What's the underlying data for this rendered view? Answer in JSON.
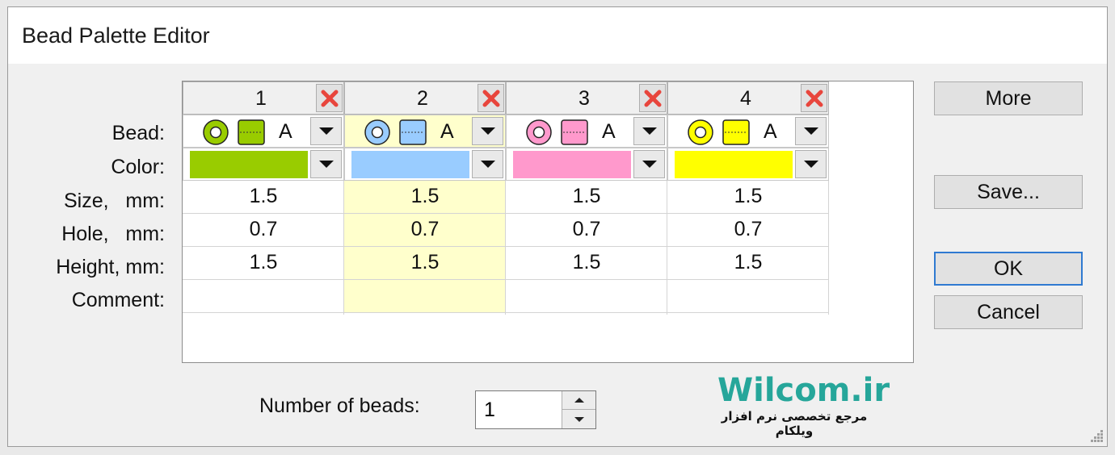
{
  "window": {
    "title": "Bead Palette Editor"
  },
  "row_labels": {
    "bead": "Bead:",
    "color": "Color:",
    "size": "Size,   mm:",
    "hole": "Hole,   mm:",
    "height": "Height, mm:",
    "comment": "Comment:"
  },
  "columns": [
    {
      "number": "1",
      "letter": "A",
      "color": "#99cc00",
      "size": "1.5",
      "hole": "0.7",
      "height": "1.5",
      "comment": "",
      "selected": false
    },
    {
      "number": "2",
      "letter": "A",
      "color": "#99ccff",
      "size": "1.5",
      "hole": "0.7",
      "height": "1.5",
      "comment": "",
      "selected": true
    },
    {
      "number": "3",
      "letter": "A",
      "color": "#ff99cc",
      "size": "1.5",
      "hole": "0.7",
      "height": "1.5",
      "comment": "",
      "selected": false
    },
    {
      "number": "4",
      "letter": "A",
      "color": "#ffff00",
      "size": "1.5",
      "hole": "0.7",
      "height": "1.5",
      "comment": "",
      "selected": false
    }
  ],
  "buttons": {
    "more": "More",
    "save": "Save...",
    "ok": "OK",
    "cancel": "Cancel"
  },
  "number_of_beads": {
    "label": "Number of beads:",
    "value": "1"
  },
  "watermark": {
    "title": "Wilcom.ir",
    "subtitle": "مرجع تخصصی نرم افزار ویلکام"
  },
  "icons": {
    "delete": "red-x-icon",
    "bead_round": "round-bead-icon",
    "bead_cylinder": "cylinder-bead-icon",
    "dropdown": "triangle-down-icon"
  },
  "colors": {
    "accent": "#2f7ad1",
    "selected_column": "#ffffcc",
    "delete_red": "#e8453c",
    "watermark": "#26a69a"
  }
}
